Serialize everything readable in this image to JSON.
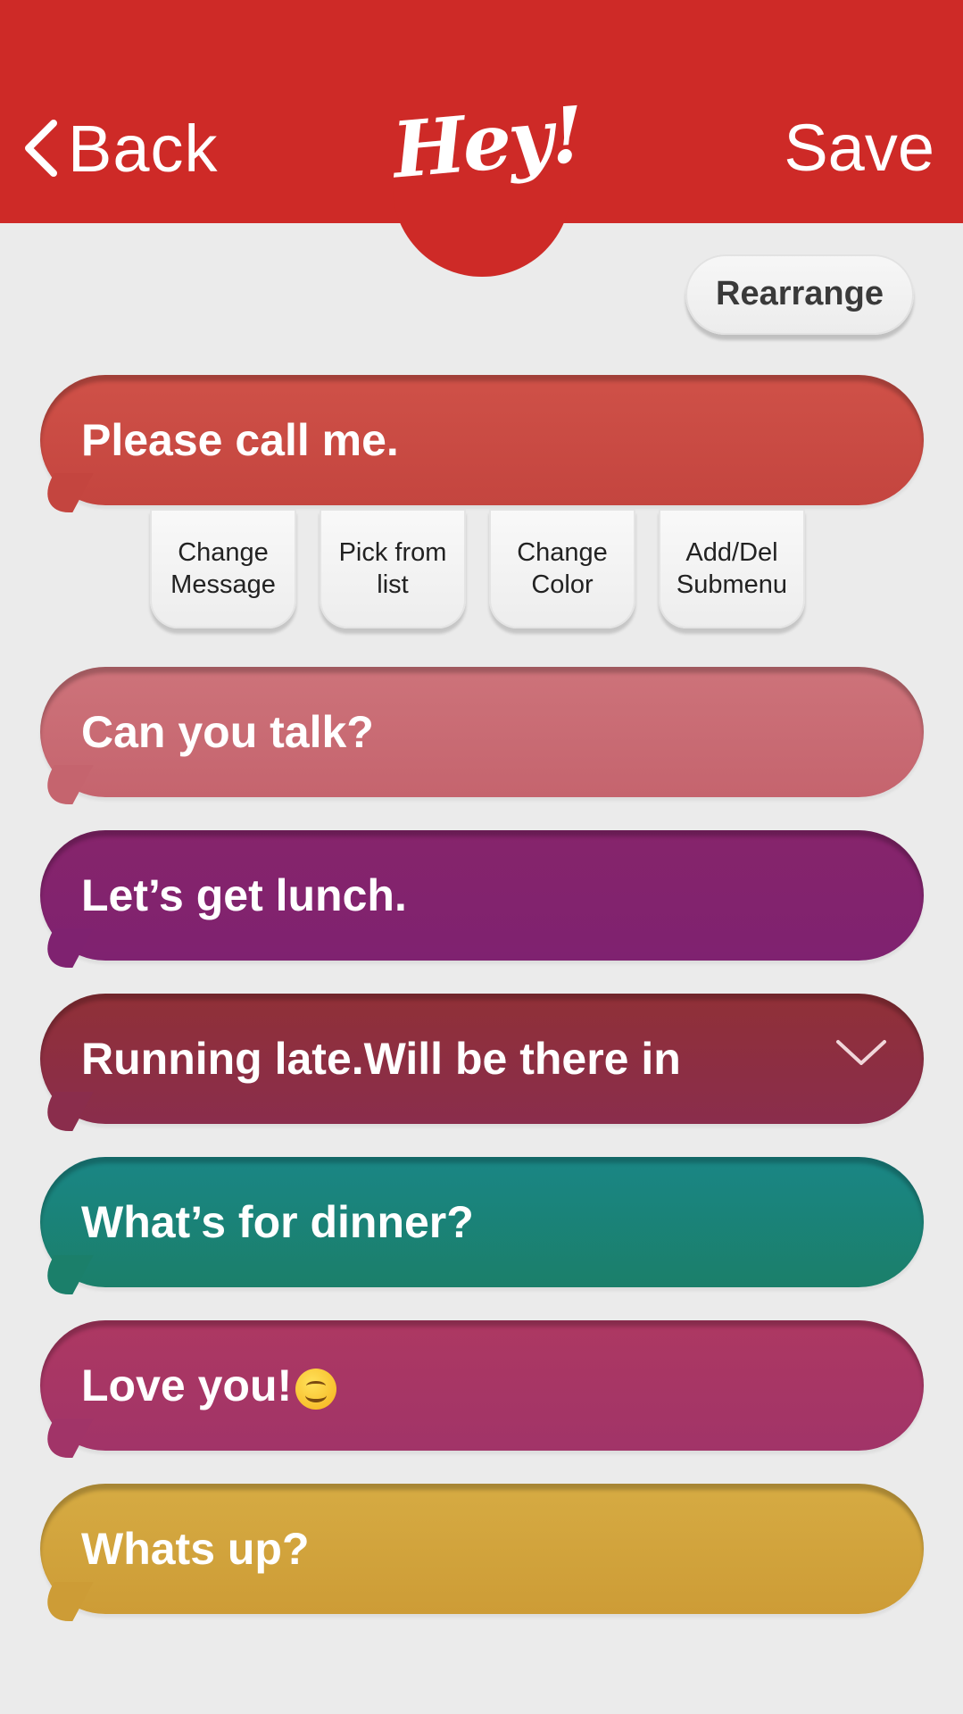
{
  "header": {
    "back_label": "Back",
    "logo_text": "Hey!",
    "save_label": "Save"
  },
  "rearrange_label": "Rearrange",
  "messages": [
    {
      "text": "Please call me.",
      "color_top": "#cf5148",
      "color_bottom": "#c4453f"
    },
    {
      "text": "Can you talk?",
      "color_top": "#cd737a",
      "color_bottom": "#c5646e"
    },
    {
      "text": "Let’s get lunch.",
      "color_top": "#86246b",
      "color_bottom": "#7f2270"
    },
    {
      "text": "Running late.Will be there in",
      "color_top": "#903037",
      "color_bottom": "#8a2d4c"
    },
    {
      "text": "What’s for dinner?",
      "color_top": "#1a8685",
      "color_bottom": "#1b7f6a"
    },
    {
      "text": "Love you!",
      "color_top": "#ad3862",
      "color_bottom": "#a13468"
    },
    {
      "text": "Whats up?",
      "color_top": "#d6ab43",
      "color_bottom": "#cd9c36"
    }
  ],
  "submenu": [
    {
      "label": "Change\nMessage"
    },
    {
      "label": "Pick from\nlist"
    },
    {
      "label": "Change\nColor"
    },
    {
      "label": "Add/Del\nSubmenu"
    }
  ],
  "icons": {
    "back": "chevron-left-icon",
    "expand": "chevron-down-icon",
    "emoji": "smiling-face-emoji"
  }
}
